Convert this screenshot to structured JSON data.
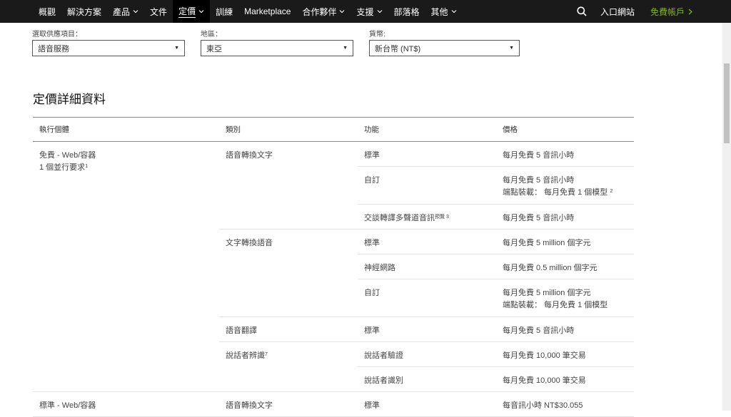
{
  "nav": {
    "items": [
      {
        "label": "概觀",
        "dropdown": false
      },
      {
        "label": "解決方案",
        "dropdown": false
      },
      {
        "label": "產品",
        "dropdown": true
      },
      {
        "label": "文件",
        "dropdown": false
      },
      {
        "label": "定價",
        "dropdown": true,
        "active": true
      },
      {
        "label": "訓練",
        "dropdown": false
      },
      {
        "label": "Marketplace",
        "dropdown": false
      },
      {
        "label": "合作夥伴",
        "dropdown": true
      },
      {
        "label": "支援",
        "dropdown": true
      },
      {
        "label": "部落格",
        "dropdown": false
      },
      {
        "label": "其他",
        "dropdown": true
      }
    ],
    "portal_label": "入口網站",
    "free_account_label": "免費帳戶",
    "accent_color": "#7fba00"
  },
  "filters": {
    "service": {
      "label": "選取供應項目：",
      "value": "語音服務"
    },
    "region": {
      "label": "地區：",
      "value": "東亞"
    },
    "currency": {
      "label": "貨幣:",
      "value": "新台幣 (NT$)"
    }
  },
  "section_title": "定價詳細資料",
  "table": {
    "headers": [
      "執行個體",
      "類別",
      "功能",
      "價格"
    ],
    "tiers": [
      {
        "name": "免費 - Web/容器",
        "note": "1 個並行要求",
        "note_sup": "1",
        "categories": [
          {
            "name": "語音轉換文字",
            "sup": "",
            "features": [
              {
                "name": "標準",
                "sup": "",
                "price": [
                  "每月免費 5 音訊小時"
                ],
                "price_sup": ""
              },
              {
                "name": "自訂",
                "sup": "",
                "price": [
                  "每月免費 5 音訊小時",
                  "端點裝載： 每月免費 1 個模型"
                ],
                "price_sup": "2"
              },
              {
                "name": "交談轉譯多聲道音訊",
                "sup": "預覽 3",
                "price": [
                  "每月免費 5 音訊小時"
                ],
                "price_sup": ""
              }
            ]
          },
          {
            "name": "文字轉換語音",
            "sup": "",
            "features": [
              {
                "name": "標準",
                "sup": "",
                "price": [
                  "每月免費 5 million 個字元"
                ],
                "price_sup": ""
              },
              {
                "name": "神經網路",
                "sup": "",
                "price": [
                  "每月免費 0.5 million 個字元"
                ],
                "price_sup": ""
              },
              {
                "name": "自訂",
                "sup": "",
                "price": [
                  "每月免費 5 million 個字元",
                  "端點裝載： 每月免費 1 個模型"
                ],
                "price_sup": ""
              }
            ]
          },
          {
            "name": "語音翻譯",
            "sup": "",
            "features": [
              {
                "name": "標準",
                "sup": "",
                "price": [
                  "每月免費 5 音訊小時"
                ],
                "price_sup": ""
              }
            ]
          },
          {
            "name": "說話者辨識",
            "sup": "7",
            "features": [
              {
                "name": "說話者驗證",
                "sup": "",
                "price": [
                  "每月免費 10,000 筆交易"
                ],
                "price_sup": ""
              },
              {
                "name": "說話者識別",
                "sup": "",
                "price": [
                  "每月免費 10,000 筆交易"
                ],
                "price_sup": ""
              }
            ]
          }
        ]
      },
      {
        "name": "標準 - Web/容器",
        "note": "",
        "note_sup": "",
        "categories": [
          {
            "name": "語音轉換文字",
            "sup": "",
            "features": [
              {
                "name": "標準",
                "sup": "",
                "price": [
                  "每音訊小時 NT$30.055"
                ],
                "price_sup": ""
              }
            ]
          }
        ]
      }
    ]
  }
}
